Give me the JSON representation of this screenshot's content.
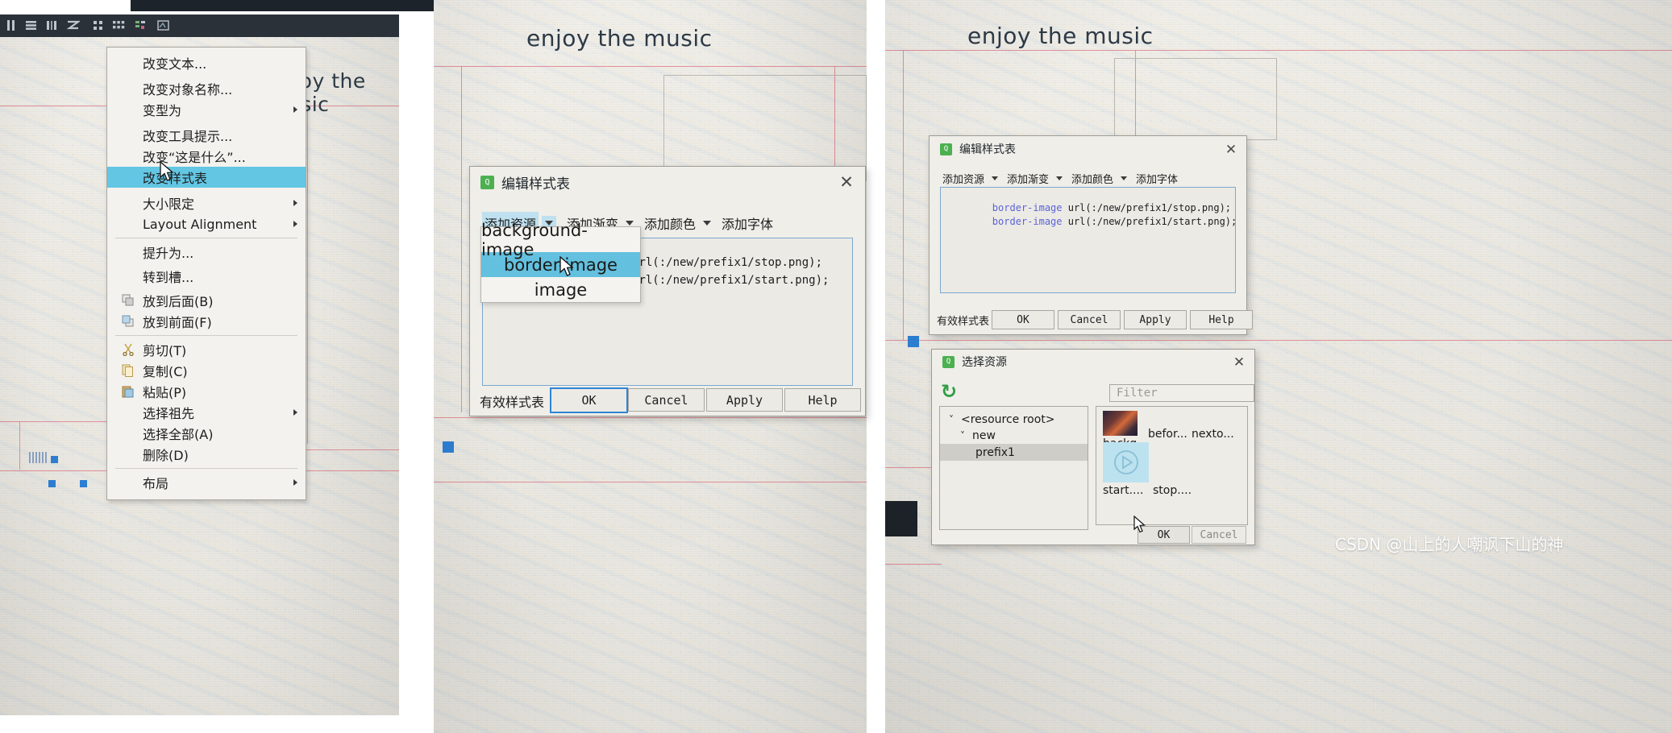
{
  "app": {
    "canvas_title": "enjoy the music"
  },
  "toolbar": {
    "icons": [
      "break-layout-icon",
      "layout-vertical-icon",
      "layout-horizontal-icon",
      "layout-splitter-icon",
      "layout-form-icon",
      "layout-grid-icon",
      "adjust-size-icon",
      "buddy-edit-icon"
    ]
  },
  "context_menu": {
    "items": [
      {
        "label": "改变文本...",
        "icon": "",
        "submenu": false,
        "selected": false
      },
      {
        "label": "改变对象名称...",
        "icon": "",
        "submenu": false,
        "selected": false
      },
      {
        "label": "变型为",
        "icon": "",
        "submenu": true,
        "selected": false
      },
      {
        "label": "改变工具提示...",
        "icon": "",
        "submenu": false,
        "selected": false
      },
      {
        "label": "改变“这是什么”...",
        "icon": "",
        "submenu": false,
        "selected": false
      },
      {
        "label": "改变样式表",
        "icon": "",
        "submenu": false,
        "selected": true
      },
      {
        "label": "大小限定",
        "icon": "",
        "submenu": true,
        "selected": false
      },
      {
        "label": "Layout Alignment",
        "icon": "",
        "submenu": true,
        "selected": false
      },
      {
        "label": "提升为...",
        "icon": "",
        "submenu": false,
        "selected": false
      },
      {
        "label": "转到槽...",
        "icon": "",
        "submenu": false,
        "selected": false
      },
      {
        "label": "放到后面(B)",
        "icon": "send-to-back-icon",
        "submenu": false,
        "selected": false
      },
      {
        "label": "放到前面(F)",
        "icon": "bring-to-front-icon",
        "submenu": false,
        "selected": false
      },
      {
        "label": "剪切(T)",
        "icon": "cut-icon",
        "submenu": false,
        "selected": false
      },
      {
        "label": "复制(C)",
        "icon": "copy-icon",
        "submenu": false,
        "selected": false
      },
      {
        "label": "粘贴(P)",
        "icon": "paste-icon",
        "submenu": false,
        "selected": false
      },
      {
        "label": "选择祖先",
        "icon": "",
        "submenu": true,
        "selected": false
      },
      {
        "label": "选择全部(A)",
        "icon": "",
        "submenu": false,
        "selected": false
      },
      {
        "label": "删除(D)",
        "icon": "",
        "submenu": false,
        "selected": false
      },
      {
        "label": "布局",
        "icon": "",
        "submenu": true,
        "selected": false
      }
    ]
  },
  "stylesheet_dialog": {
    "title": "编辑样式表",
    "close_label": "✕",
    "tools": [
      {
        "label": "添加资源",
        "caret": true,
        "active": true
      },
      {
        "label": "添加渐变",
        "caret": true,
        "active": false
      },
      {
        "label": "添加颜色",
        "caret": true,
        "active": false
      },
      {
        "label": "添加字体",
        "caret": false,
        "active": false
      }
    ],
    "css_lines": [
      {
        "prop": "border-image",
        "value": " url(:/new/prefix1/stop.png);"
      },
      {
        "prop": "border-image",
        "value": " url(:/new/prefix1/start.png);"
      }
    ],
    "valid_label": "有效样式表",
    "buttons": [
      "OK",
      "Cancel",
      "Apply",
      "Help"
    ],
    "default_button": "OK"
  },
  "resource_dropdown": {
    "options": [
      "background-image",
      "border-image",
      "image"
    ],
    "selected": "border-image"
  },
  "resource_dialog": {
    "title": "选择资源",
    "close_label": "✕",
    "refresh_icon": "refresh-icon",
    "filter_placeholder": "Filter",
    "tree": [
      {
        "label": "<resource root>",
        "depth": 0,
        "expanded": true,
        "selected": false
      },
      {
        "label": "new",
        "depth": 1,
        "expanded": true,
        "selected": false
      },
      {
        "label": "prefix1",
        "depth": 2,
        "expanded": null,
        "selected": true
      }
    ],
    "files": [
      {
        "caption": "backg...",
        "kind": "photo-thumb"
      },
      {
        "caption": "befor...",
        "kind": "blank-thumb"
      },
      {
        "caption": "nexto...",
        "kind": "blank-thumb"
      },
      {
        "caption": "start....",
        "kind": "play-thumb",
        "selected": true
      },
      {
        "caption": "stop....",
        "kind": "blank-thumb"
      }
    ],
    "buttons": [
      "OK",
      "Cancel"
    ]
  },
  "watermark": "CSDN @山上的人嘲讽下山的神",
  "colors": {
    "highlight": "#63c6e3",
    "accent_blue": "#2e86d6",
    "css_prop": "#5a63d8",
    "redline": "#e0808c",
    "toolbar_bg": "#2a3138"
  }
}
